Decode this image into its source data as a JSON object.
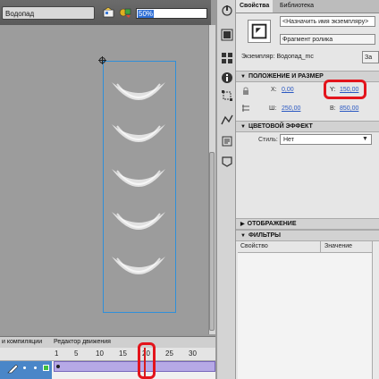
{
  "editor": {
    "scene_name": "Водопад",
    "zoom": "50%"
  },
  "timeline": {
    "tabs": [
      "и компиляции",
      "Редактор движения"
    ],
    "ruler": [
      "1",
      "5",
      "10",
      "15",
      "20",
      "25",
      "30"
    ],
    "current_frame": 20
  },
  "panel": {
    "tabs": [
      "Свойства",
      "Библиотека"
    ],
    "instance_name_placeholder": "<Назначить имя экземпляру>",
    "instance_type": "Фрагмент ролика",
    "instance_label": "Экземпляр:",
    "instance_value": "Водопад_mc",
    "swap_label": "За",
    "sections": {
      "position_size": "ПОЛОЖЕНИЕ И РАЗМЕР",
      "color_effect": "ЦВЕТОВОЙ ЭФФЕКТ",
      "display": "ОТОБРАЖЕНИЕ",
      "filters": "ФИЛЬТРЫ"
    },
    "x_label": "X:",
    "x_value": "0,00",
    "y_label": "Y:",
    "y_value": "150,00",
    "w_label": "Ш:",
    "w_value": "250,00",
    "h_label": "В:",
    "h_value": "850,00",
    "style_label": "Стиль:",
    "style_value": "Нет",
    "filter_columns": [
      "Свойство",
      "Значение"
    ]
  },
  "colors": {
    "highlight": "#e3141c",
    "selection": "#2f8fd9",
    "motion_tween": "#b6a9e6"
  }
}
